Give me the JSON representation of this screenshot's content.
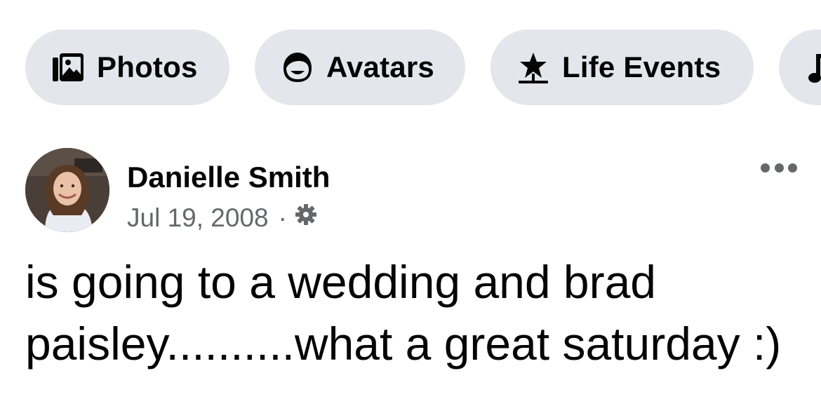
{
  "chips": [
    {
      "label": "Photos",
      "icon": "photos-icon"
    },
    {
      "label": "Avatars",
      "icon": "avatar-icon"
    },
    {
      "label": "Life Events",
      "icon": "star-flag-icon"
    },
    {
      "label": "",
      "icon": "music-note-icon"
    }
  ],
  "post": {
    "author": "Danielle Smith",
    "date": "Jul 19, 2008",
    "separator": "·",
    "privacy_icon": "gear-icon",
    "more_icon": "more-dots-icon",
    "text": "is going to a wedding and brad paisley..........what a great saturday :)"
  },
  "colors": {
    "chip_bg": "#e4e6eb",
    "secondary_text": "#65676b",
    "primary_text": "#050505"
  }
}
